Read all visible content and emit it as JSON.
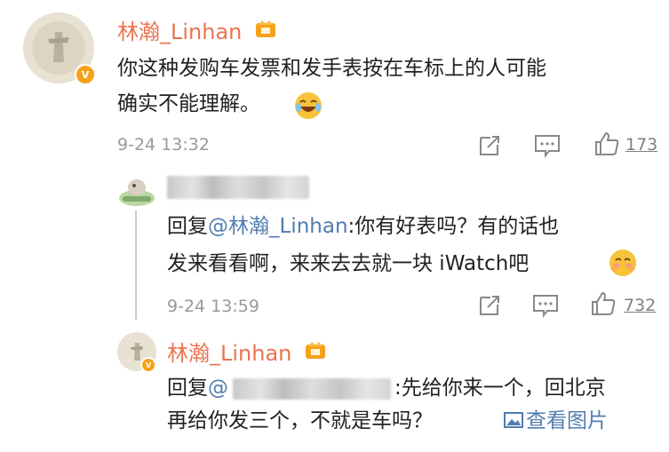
{
  "main_comment": {
    "user": "林瀚_Linhan",
    "verified": "V",
    "text_line1": "你这种发购车发票和发手表按在车标上的人可能",
    "text_line2": "确实不能理解。",
    "time": "9-24 13:32",
    "like_count": "173"
  },
  "reply1": {
    "reply_word": "回复",
    "mention": "@林瀚_Linhan",
    "text_line1_rest": ":你有好表吗？有的话也",
    "text_line2": "发来看看啊，来来去去就一块 iWatch吧",
    "time": "9-24 13:59",
    "like_count": "732"
  },
  "reply2": {
    "user": "林瀚_Linhan",
    "verified": "V",
    "reply_word": "回复",
    "mention_prefix": "@",
    "text_line1_rest": ":先给你来一个，回北京",
    "text_line2": "再给你发三个，不就是车吗？",
    "view_image": "查看图片"
  },
  "icons": [
    "vip-crown-icon",
    "laugh-emoji-icon",
    "forward-icon",
    "comment-icon",
    "like-icon",
    "blush-emoji-icon",
    "image-icon"
  ],
  "colors": {
    "username": "#eb7350",
    "mention": "#507daf",
    "meta": "#999999",
    "badge": "#f6a11b"
  }
}
